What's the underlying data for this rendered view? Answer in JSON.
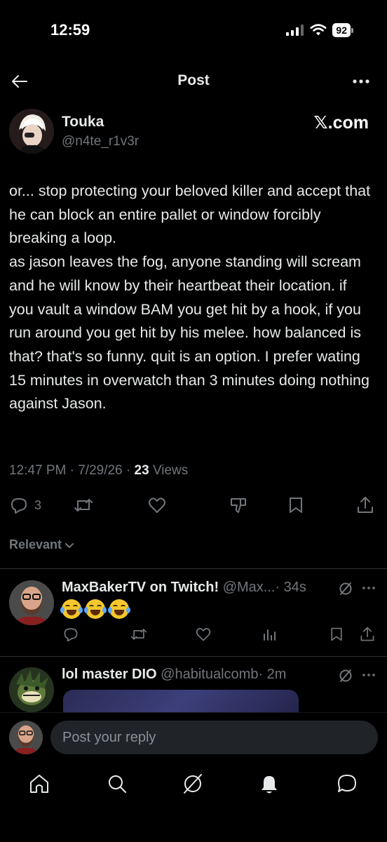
{
  "status_bar": {
    "time": "12:59",
    "battery": "92"
  },
  "header": {
    "title": "Post"
  },
  "author": {
    "name": "Touka",
    "handle": "@n4te_r1v3r",
    "source": "𝕏.com"
  },
  "post": {
    "text": "or... stop protecting your beloved killer and accept that he can block an entire pallet or window forcibly breaking a loop.\nas jason leaves the fog, anyone standing will scream and he will know by their heartbeat their location. if you vault a window BAM you get hit by a hook, if you run around you get hit by his melee. how balanced is that? that's so funny. quit is an option. I prefer wating 15 minutes in overwatch than 3 minutes doing nothing against Jason.",
    "time": "12:47 PM",
    "date": "7/29/26",
    "sep": "·",
    "views_count": "23",
    "views_label": "Views",
    "reply_count": "3"
  },
  "sort": {
    "label": "Relevant"
  },
  "replies": [
    {
      "name": "MaxBakerTV on Twitch!",
      "handle": "@Max...",
      "time": "· 34s"
    },
    {
      "name": "lol master DIO",
      "handle": "@habitualcomb",
      "time": "· 2m"
    }
  ],
  "compose": {
    "placeholder": "Post your reply"
  },
  "icons": [
    "back-arrow-icon",
    "more-icon",
    "reply-icon",
    "repost-icon",
    "like-icon",
    "downvote-icon",
    "bookmark-icon",
    "share-icon",
    "grok-icon",
    "views-icon",
    "home-icon",
    "search-icon",
    "bell-icon",
    "messages-icon"
  ],
  "colors": {
    "background": "#000000",
    "text": "#e7e9ea",
    "muted": "#71767b",
    "divider": "#2f3336",
    "input_bg": "#202327"
  }
}
